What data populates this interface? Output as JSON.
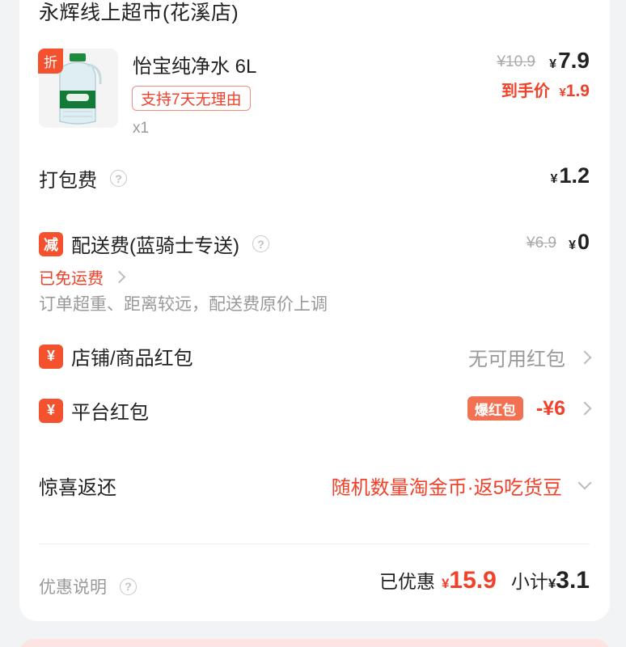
{
  "store": {
    "title": "永辉线上超市(花溪店)"
  },
  "product": {
    "discount_tag": "折",
    "name": "怡宝纯净水 6L",
    "return_badge": "支持7天无理由",
    "quantity": "x1",
    "original_price": "¥10.9",
    "price_yen": "¥",
    "price": "7.9",
    "final_label": "到手价",
    "final_yen": "¥",
    "final_price": "1.9",
    "image_label": "怡宝"
  },
  "packing": {
    "label": "打包费",
    "help_icon": "?",
    "yen": "¥",
    "value": "1.2"
  },
  "delivery": {
    "badge": "减",
    "label": "配送费(蓝骑士专送)",
    "help_icon": "?",
    "original": "¥6.9",
    "yen": "¥",
    "value": "0",
    "free_shipping": "已免运费",
    "note": "订单超重、距离较远，配送费原价上调"
  },
  "shop_coupon": {
    "badge": "¥",
    "label": "店铺/商品红包",
    "value": "无可用红包"
  },
  "platform_coupon": {
    "badge": "¥",
    "label": "平台红包",
    "boom": "爆红包",
    "value": "-¥6"
  },
  "surprise": {
    "label": "惊喜返还",
    "value": "随机数量淘金币·返5吃货豆"
  },
  "summary": {
    "label": "优惠说明",
    "help_icon": "?",
    "saved_label": "已优惠",
    "saved_yen": "¥",
    "saved_value": "15.9",
    "subtotal_label": "小计",
    "subtotal_yen": "¥",
    "subtotal_value": "3.1"
  },
  "colors": {
    "accent": "#f0412a",
    "badge": "#f4512f",
    "gray": "#999999"
  }
}
